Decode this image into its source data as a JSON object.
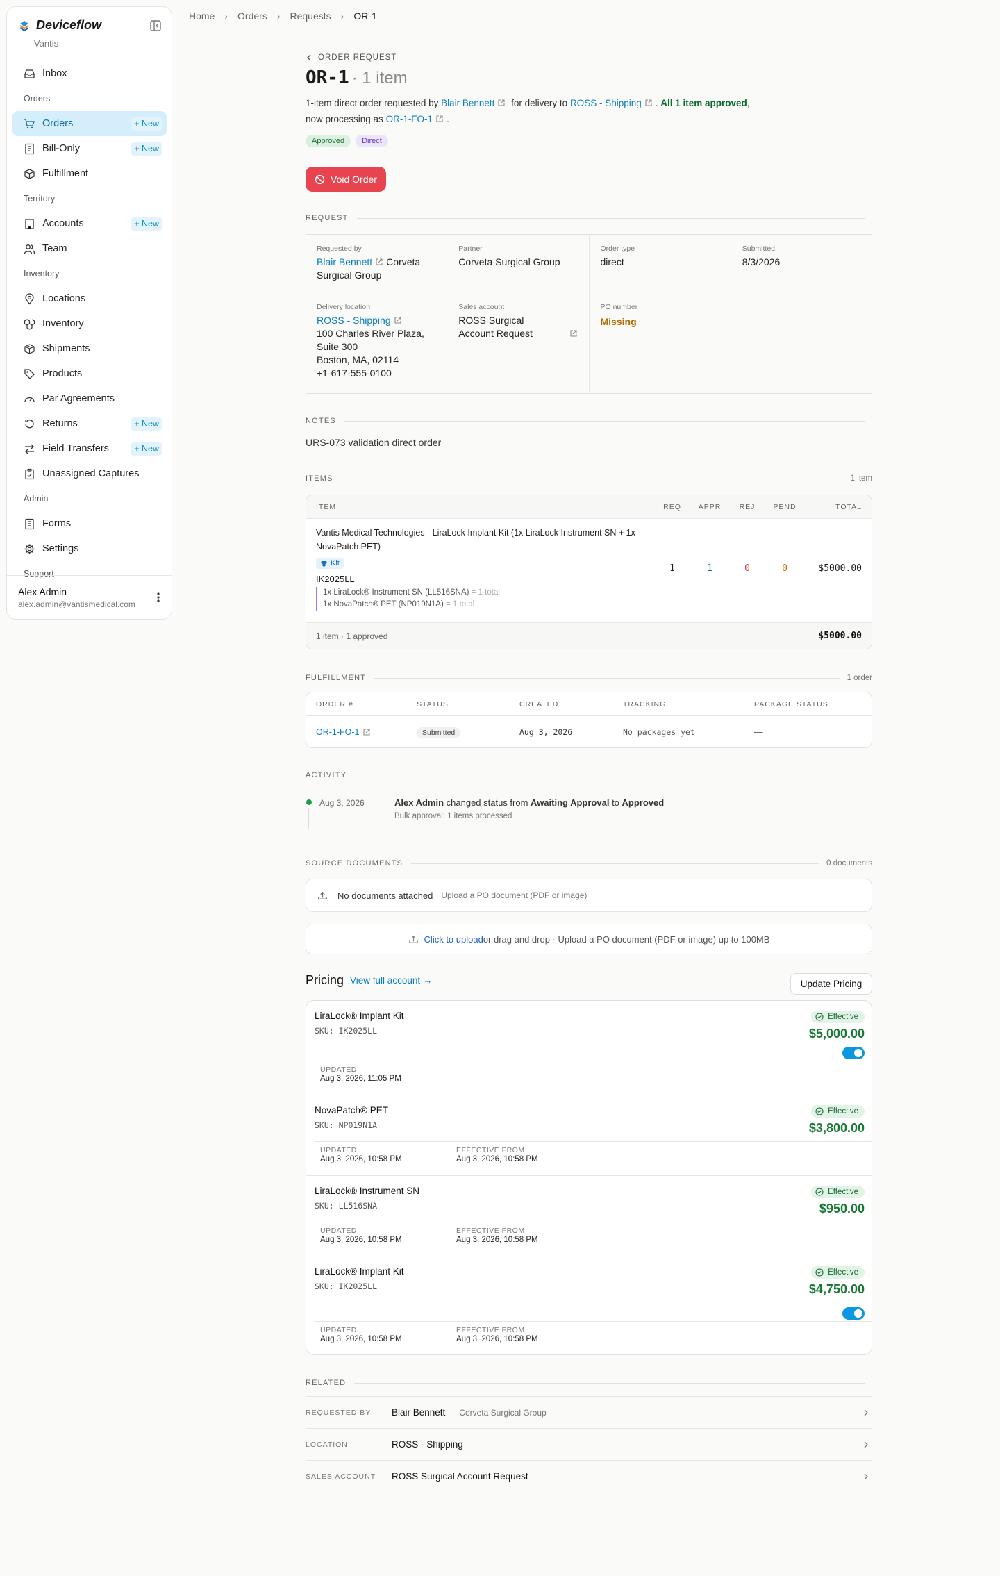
{
  "sidebar": {
    "brand": "Deviceflow",
    "org": "Vantis",
    "items": [
      {
        "type": "item",
        "label": "Inbox",
        "icon": "inbox-icon"
      },
      {
        "type": "section",
        "label": "Orders"
      },
      {
        "type": "item",
        "label": "Orders",
        "icon": "cart-icon",
        "active": true,
        "new": "+ New"
      },
      {
        "type": "item",
        "label": "Bill-Only",
        "icon": "receipt-icon",
        "new": "+ New"
      },
      {
        "type": "item",
        "label": "Fulfillment",
        "icon": "box-icon"
      },
      {
        "type": "section",
        "label": "Territory"
      },
      {
        "type": "item",
        "label": "Accounts",
        "icon": "building-icon",
        "new": "+ New"
      },
      {
        "type": "item",
        "label": "Team",
        "icon": "users-icon"
      },
      {
        "type": "section",
        "label": "Inventory"
      },
      {
        "type": "item",
        "label": "Locations",
        "icon": "pin-icon"
      },
      {
        "type": "item",
        "label": "Inventory",
        "icon": "boxes-icon"
      },
      {
        "type": "item",
        "label": "Shipments",
        "icon": "package-icon"
      },
      {
        "type": "item",
        "label": "Products",
        "icon": "tag-icon"
      },
      {
        "type": "item",
        "label": "Par Agreements",
        "icon": "gauge-icon"
      },
      {
        "type": "item",
        "label": "Returns",
        "icon": "return-icon",
        "new": "+ New"
      },
      {
        "type": "item",
        "label": "Field Transfers",
        "icon": "transfer-icon",
        "new": "+ New"
      },
      {
        "type": "item",
        "label": "Unassigned Captures",
        "icon": "clipboard-icon"
      },
      {
        "type": "section",
        "label": "Admin"
      },
      {
        "type": "item",
        "label": "Forms",
        "icon": "form-icon"
      },
      {
        "type": "item",
        "label": "Settings",
        "icon": "gear-icon"
      },
      {
        "type": "section",
        "label": "Support"
      }
    ],
    "user": {
      "name": "Alex Admin",
      "email": "alex.admin@vantismedical.com"
    }
  },
  "breadcrumbs": [
    "Home",
    "Orders",
    "Requests",
    "OR-1"
  ],
  "header": {
    "eyebrow": "ORDER REQUEST",
    "order_id": "OR-1",
    "item_count": "· 1 item",
    "summary": {
      "p1": "1-item direct order requested by ",
      "requester": "Blair Bennett",
      "p2": " for delivery to ",
      "location": "ROSS - Shipping",
      "p3": ". ",
      "approved": "All 1 item approved",
      "p4": ", now processing as ",
      "fo": "OR-1-FO-1",
      "p5": "."
    },
    "badges": [
      "Approved",
      "Direct"
    ],
    "void_label": "Void Order"
  },
  "request": {
    "heading": "REQUEST",
    "requested_by_label": "Requested by",
    "requested_by": "Blair Bennett",
    "requested_by_org": "Corveta Surgical Group",
    "partner_label": "Partner",
    "partner": "Corveta Surgical Group",
    "order_type_label": "Order type",
    "order_type": "direct",
    "submitted_label": "Submitted",
    "submitted": "8/3/2026",
    "delivery_label": "Delivery location",
    "delivery_name": "ROSS - Shipping",
    "delivery_addr1": "100 Charles River Plaza,",
    "delivery_addr2": "Suite 300",
    "delivery_addr3": "Boston, MA, 02114",
    "delivery_phone": "+1-617-555-0100",
    "sales_label": "Sales account",
    "sales_account": "ROSS Surgical Account Request",
    "po_label": "PO number",
    "po": "Missing"
  },
  "notes": {
    "heading": "NOTES",
    "text": "URS-073 validation direct order"
  },
  "items": {
    "heading": "ITEMS",
    "count": "1 item",
    "columns": [
      "ITEM",
      "REQ",
      "APPR",
      "REJ",
      "PEND",
      "TOTAL"
    ],
    "row": {
      "name": "Vantis Medical Technologies - LiraLock Implant Kit (1x LiraLock Instrument SN + 1x NovaPatch PET)",
      "kit_label": "Kit",
      "sku": "IK2025LL",
      "components": [
        {
          "name": "1x LiraLock® Instrument SN (LL516SNA)",
          "total": " = 1 total"
        },
        {
          "name": "1x NovaPatch® PET (NP019N1A)",
          "total": " = 1 total"
        }
      ],
      "req": "1",
      "appr": "1",
      "rej": "0",
      "pend": "0",
      "total": "$5000.00"
    },
    "footer_left": "1 item · 1 approved",
    "footer_total": "$5000.00"
  },
  "fulfillment": {
    "heading": "FULFILLMENT",
    "count": "1 order",
    "columns": [
      "ORDER #",
      "STATUS",
      "CREATED",
      "TRACKING",
      "PACKAGE STATUS"
    ],
    "row": {
      "order": "OR-1-FO-1",
      "status": "Submitted",
      "created": "Aug 3, 2026",
      "tracking": "No packages yet",
      "package": "—"
    }
  },
  "activity": {
    "heading": "ACTIVITY",
    "date": "Aug 3, 2026",
    "actor": "Alex Admin",
    "t1": " changed status from ",
    "from": "Awaiting Approval",
    "t2": " to ",
    "to": "Approved",
    "sub": "Bulk approval: 1 items processed"
  },
  "documents": {
    "heading": "SOURCE DOCUMENTS",
    "count": "0 documents",
    "none": "No documents attached",
    "none_hint": "Upload a PO document (PDF or image)",
    "click": "Click to upload",
    "rest": " or drag and drop · Upload a PO document (PDF or image) up to 100MB"
  },
  "pricing": {
    "title": "Pricing",
    "view": "View full account →",
    "update": "Update Pricing",
    "updated_label": "UPDATED",
    "from_label": "EFFECTIVE FROM",
    "rows": [
      {
        "name": "LiraLock® Implant Kit",
        "sku": "SKU: IK2025LL",
        "status": "Effective",
        "price": "$5,000.00",
        "updated": "Aug 3, 2026, 11:05 PM",
        "from": ""
      },
      {
        "name": "NovaPatch® PET",
        "sku": "SKU: NP019N1A",
        "status": "Effective",
        "price": "$3,800.00",
        "updated": "Aug 3, 2026, 10:58 PM",
        "from": "Aug 3, 2026, 10:58 PM"
      },
      {
        "name": "LiraLock® Instrument SN",
        "sku": "SKU: LL516SNA",
        "status": "Effective",
        "price": "$950.00",
        "updated": "Aug 3, 2026, 10:58 PM",
        "from": "Aug 3, 2026, 10:58 PM"
      },
      {
        "name": "LiraLock® Implant Kit",
        "sku": "SKU: IK2025LL",
        "status": "Effective",
        "price": "$4,750.00",
        "updated": "Aug 3, 2026, 10:58 PM",
        "from": "Aug 3, 2026, 10:58 PM"
      }
    ]
  },
  "related": {
    "heading": "RELATED",
    "rows": [
      {
        "k": "REQUESTED BY",
        "v": "Blair Bennett",
        "s": "Corveta Surgical Group"
      },
      {
        "k": "LOCATION",
        "v": "ROSS - Shipping",
        "s": ""
      },
      {
        "k": "SALES ACCOUNT",
        "v": "ROSS Surgical Account Request",
        "s": ""
      }
    ]
  },
  "colors": {
    "accent": "#0c7fc0",
    "danger": "#e84450",
    "success": "#1a7a35"
  }
}
